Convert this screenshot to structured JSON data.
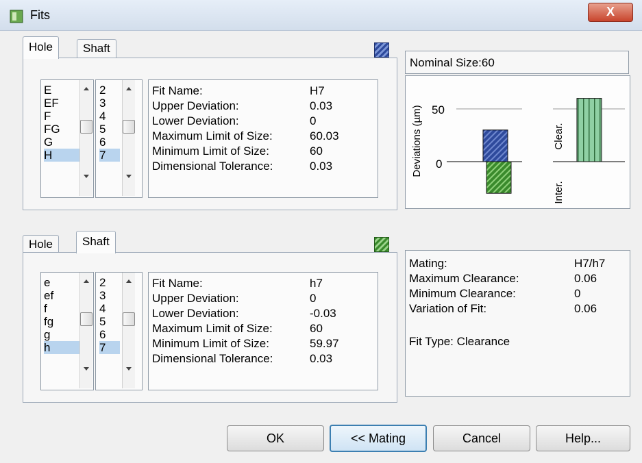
{
  "window": {
    "title": "Fits",
    "close_label": "X"
  },
  "hole_panel": {
    "tabs": [
      "Hole",
      "Shaft"
    ],
    "letters": [
      "E",
      "EF",
      "F",
      "FG",
      "G",
      "H"
    ],
    "grades": [
      "2",
      "3",
      "4",
      "5",
      "6",
      "7"
    ],
    "info_labels": [
      "Fit Name:",
      "Upper Deviation:",
      "Lower Deviation:",
      "Maximum Limit of Size:",
      "Minimum Limit of Size:",
      "Dimensional Tolerance:"
    ],
    "info_values": [
      "H7",
      "0.03",
      "0",
      "60.03",
      "60",
      "0.03"
    ]
  },
  "shaft_panel": {
    "tabs": [
      "Hole",
      "Shaft"
    ],
    "letters": [
      "e",
      "ef",
      "f",
      "fg",
      "g",
      "h"
    ],
    "grades": [
      "2",
      "3",
      "4",
      "5",
      "6",
      "7"
    ],
    "info_labels": [
      "Fit Name:",
      "Upper Deviation:",
      "Lower Deviation:",
      "Maximum Limit of Size:",
      "Minimum Limit of Size:",
      "Dimensional Tolerance:"
    ],
    "info_values": [
      "h7",
      "0",
      "-0.03",
      "60",
      "59.97",
      "0.03"
    ]
  },
  "chart": {
    "nominal_size": "Nominal Size:60",
    "ylabel": "Deviations (µm)",
    "tick_50": "50",
    "tick_0": "0",
    "inter_label": "Inter.",
    "clear_label": "Clear.",
    "hole_color": "#2e4a9c",
    "shaft_color": "#3a8a2c",
    "clear_color": "#8fd0a4"
  },
  "chart_data": {
    "type": "bar",
    "categories": [
      "Hole H7",
      "Shaft h7"
    ],
    "series": [
      {
        "values": [
          [
            0,
            30
          ],
          [
            -30,
            0
          ]
        ]
      }
    ],
    "clearance_bar": [
      0,
      60
    ],
    "ylabel": "Deviations (µm)",
    "yticks": [
      0,
      50
    ]
  },
  "mating": {
    "labels": [
      "Mating:",
      "Maximum Clearance:",
      "Minimum Clearance:",
      "Variation of Fit:"
    ],
    "values": [
      "H7/h7",
      "0.06",
      "0",
      "0.06"
    ],
    "fit_type": "Fit Type: Clearance"
  },
  "buttons": {
    "ok": "OK",
    "mating": "<< Mating",
    "cancel": "Cancel",
    "help": "Help..."
  }
}
